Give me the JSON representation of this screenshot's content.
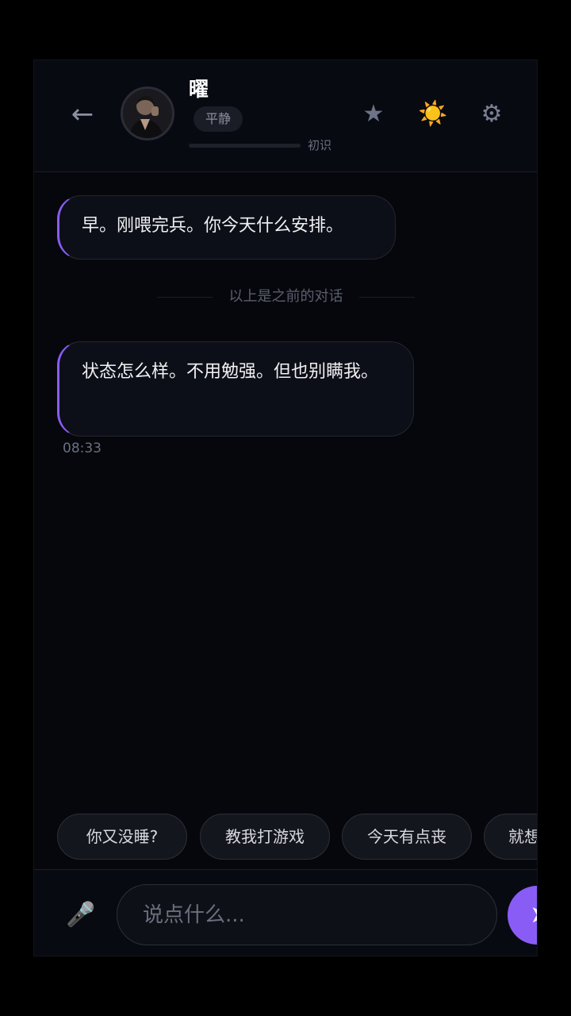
{
  "header": {
    "back_icon": "←",
    "name": "曜",
    "mood": "平静",
    "affinity_label": "初识",
    "affinity_level": 0.0,
    "favorite_icon": "★",
    "weather_icon": "☀️",
    "settings_icon": "⚙",
    "accent_color": "#8a5cf6"
  },
  "messages": [
    {
      "text": "早。刚喂完兵。你今天什么安排。"
    },
    {
      "text": "状态怎么样。不用勉强。但也别瞒我。",
      "time": "08:33"
    }
  ],
  "history_divider": "以上是之前的对话",
  "quick_replies": [
    "你又没睡?",
    "教我打游戏",
    "今天有点丧",
    "就想"
  ],
  "input": {
    "mic_icon": "🎤",
    "placeholder": "说点什么...",
    "send_icon": "➤"
  }
}
